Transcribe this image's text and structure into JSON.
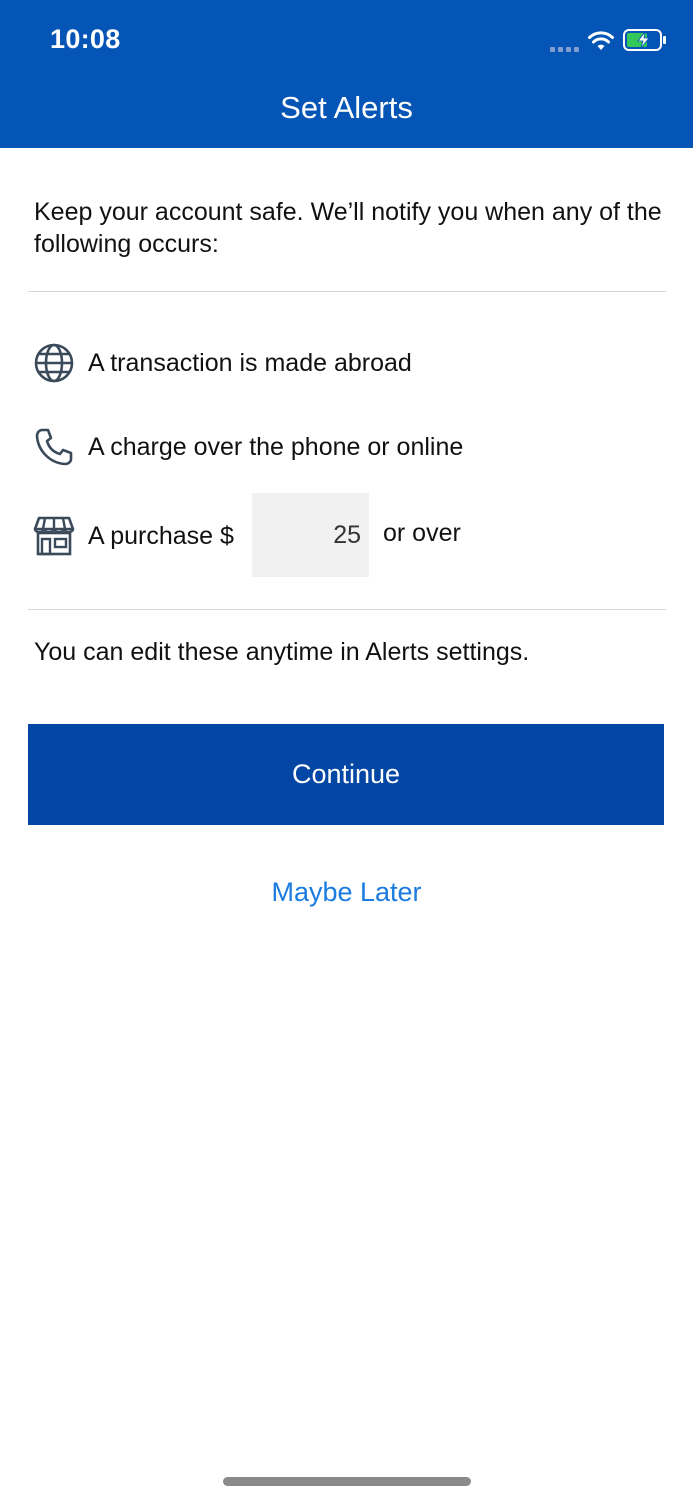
{
  "status_bar": {
    "time": "10:08",
    "icons": [
      "signal-dots-icon",
      "wifi-icon",
      "battery-charging-icon"
    ],
    "battery_color": "#34c759"
  },
  "header": {
    "title": "Set Alerts",
    "background": "#0455b5"
  },
  "intro": {
    "text": "Keep your account safe. We’ll notify you when any of the following occurs:"
  },
  "alerts": [
    {
      "icon": "globe-icon",
      "label": "A transaction is made abroad"
    },
    {
      "icon": "phone-icon",
      "label": "A charge over the phone or online"
    },
    {
      "icon": "storefront-icon",
      "label_prefix": "A purchase $",
      "amount": "25",
      "label_suffix": "or over"
    }
  ],
  "note": {
    "text": "You can edit these anytime in Alerts settings."
  },
  "buttons": {
    "continue_label": "Continue",
    "continue_color": "#0446a3",
    "later_label": "Maybe Later",
    "later_color": "#1a7be0"
  }
}
